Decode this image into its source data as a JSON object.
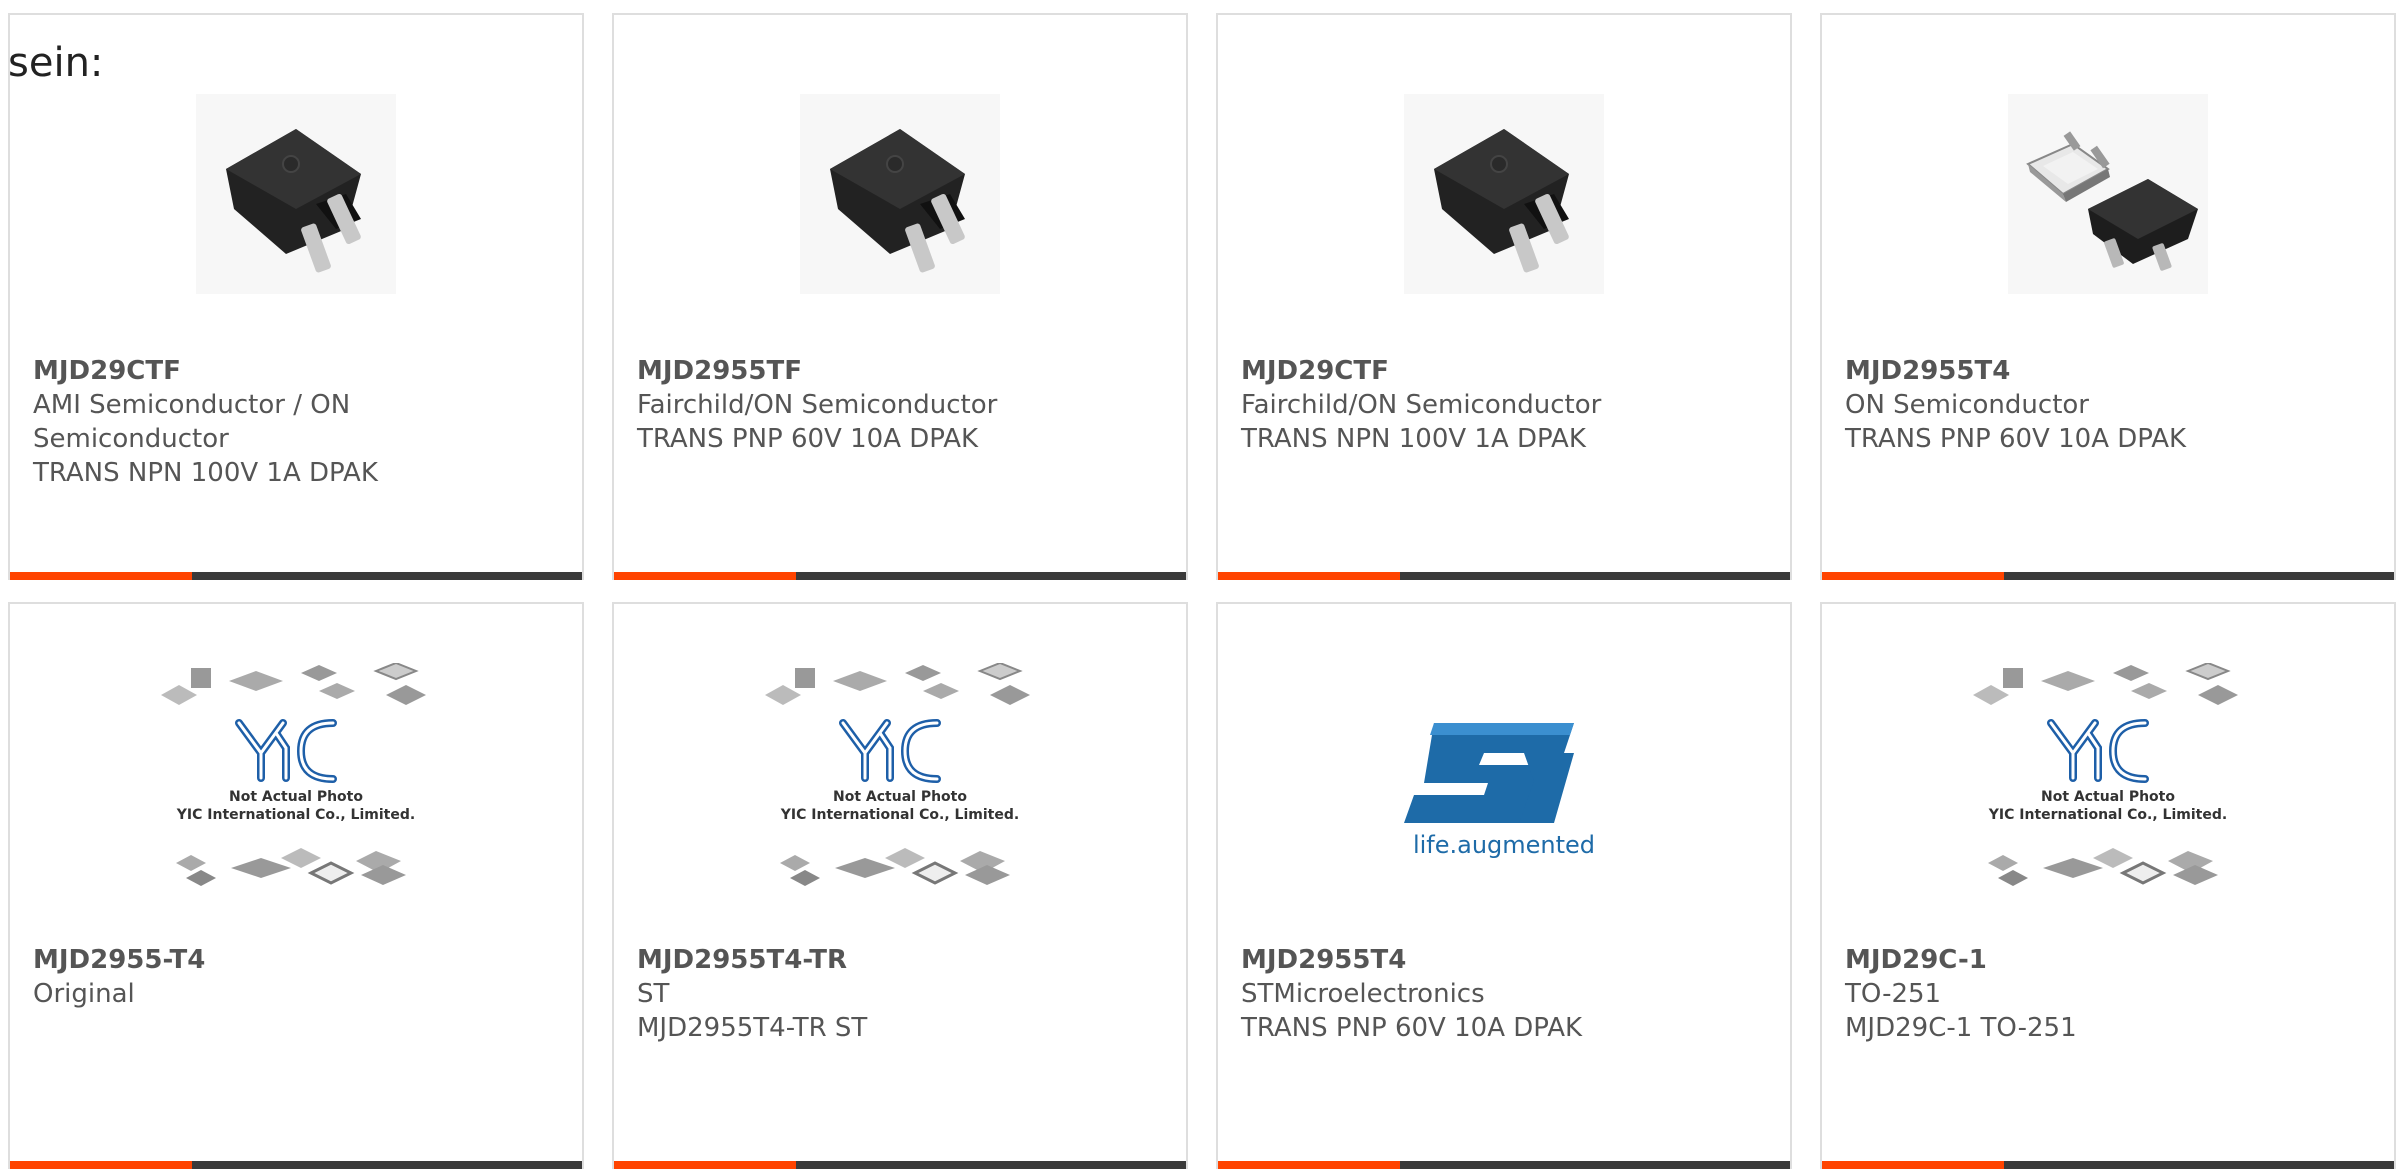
{
  "heading": "sein:",
  "colors": {
    "accent": "#ff4400",
    "bar": "#3a3a3a",
    "text": "#555555",
    "border": "#dedede"
  },
  "cards": [
    {
      "part": "MJD29CTF",
      "lines": [
        "AMI Semiconductor / ON",
        "Semiconductor",
        "TRANS NPN 100V 1A DPAK"
      ],
      "image": "dpak-package-image"
    },
    {
      "part": "MJD2955TF",
      "lines": [
        "Fairchild/ON Semiconductor",
        "TRANS PNP 60V 10A DPAK"
      ],
      "image": "dpak-package-image"
    },
    {
      "part": "MJD29CTF",
      "lines": [
        "Fairchild/ON Semiconductor",
        "TRANS NPN 100V 1A DPAK"
      ],
      "image": "dpak-package-image"
    },
    {
      "part": "MJD2955T4",
      "lines": [
        "ON Semiconductor",
        "TRANS PNP 60V 10A DPAK"
      ],
      "image": "dpak-pair-image"
    },
    {
      "part": "MJD2955-T4",
      "lines": [
        "Original"
      ],
      "image": "not-actual-photo-image",
      "placeholder_text": [
        "Not Actual Photo",
        "YIC International Co., Limited."
      ]
    },
    {
      "part": "MJD2955T4-TR",
      "lines": [
        "ST",
        "MJD2955T4-TR ST"
      ],
      "image": "not-actual-photo-image",
      "placeholder_text": [
        "Not Actual Photo",
        "YIC International Co., Limited."
      ]
    },
    {
      "part": "MJD2955T4",
      "lines": [
        "STMicroelectronics",
        "TRANS PNP 60V 10A DPAK"
      ],
      "image": "st-logo-image",
      "logo_tagline": "life.augmented"
    },
    {
      "part": "MJD29C-1",
      "lines": [
        "TO-251",
        "MJD29C-1 TO-251"
      ],
      "image": "not-actual-photo-image",
      "placeholder_text": [
        "Not Actual Photo",
        "YIC International Co., Limited."
      ]
    }
  ]
}
